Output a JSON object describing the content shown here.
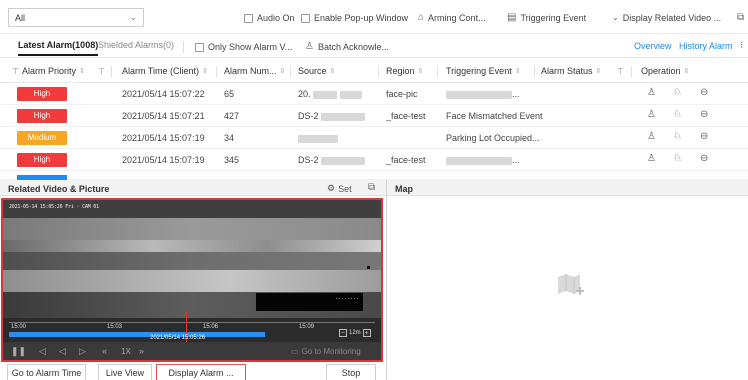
{
  "toolbar": {
    "type_select": "All",
    "audio_on": "Audio On",
    "enable_popup": "Enable Pop-up Window",
    "arming": "Arming Cont...",
    "triggering_event": "Triggering Event",
    "display_related": "Display Related Video ..."
  },
  "tabs": {
    "latest": "Latest Alarm(1008)",
    "shielded": "Shielded Alarms(0)",
    "only_show": "Only Show Alarm V...",
    "batch_ack": "Batch Acknowle...",
    "overview": "Overview",
    "history": "History Alarm"
  },
  "table": {
    "headers": {
      "priority": "Alarm Priority",
      "time": "Alarm Time (Client)",
      "num": "Alarm Num...",
      "source": "Source",
      "region": "Region",
      "trigger": "Triggering Event",
      "status": "Alarm Status",
      "operation": "Operation"
    },
    "rows": [
      {
        "priority": "High",
        "color": "#ef3b3b",
        "time": "2021/05/14 15:07:22",
        "num": "65",
        "source": "20.",
        "region": "face-pic",
        "trigger": "..."
      },
      {
        "priority": "High",
        "color": "#ef3b3b",
        "time": "2021/05/14 15:07:21",
        "num": "427",
        "source": "DS-2",
        "region": "_face-test",
        "trigger": "Face Mismatched Event"
      },
      {
        "priority": "Medium",
        "color": "#f6a623",
        "time": "2021/05/14 15:07:19",
        "num": "34",
        "source": "",
        "region": "",
        "trigger": "Parking Lot Occupied..."
      },
      {
        "priority": "High",
        "color": "#ef3b3b",
        "time": "2021/05/14 15:07:19",
        "num": "345",
        "source": "DS-2",
        "region": "_face-test",
        "trigger": "..."
      }
    ]
  },
  "video_panel": {
    "title": "Related Video & Picture",
    "set": "Set",
    "osd": "2021-05-14  15:05:26   Fri  ·  CAM 01",
    "box_text": "........",
    "ticks": [
      "15:00",
      "15:03",
      "15:06",
      "15:09"
    ],
    "cursor_time": "2021/05/14 15:05:26",
    "zoom": "12m",
    "speed": "1X",
    "go_monitoring": "Go to Monitoring",
    "buttons": {
      "goto_alarm": "Go to Alarm Time",
      "live_view": "Live View",
      "display_alarm": "Display Alarm ...",
      "stop": "Stop"
    }
  },
  "map_panel": {
    "title": "Map"
  },
  "colors": {
    "accent": "#1d8bf0",
    "high": "#ef3b3b",
    "medium": "#f6a623",
    "highlight_border": "#d9363e"
  }
}
